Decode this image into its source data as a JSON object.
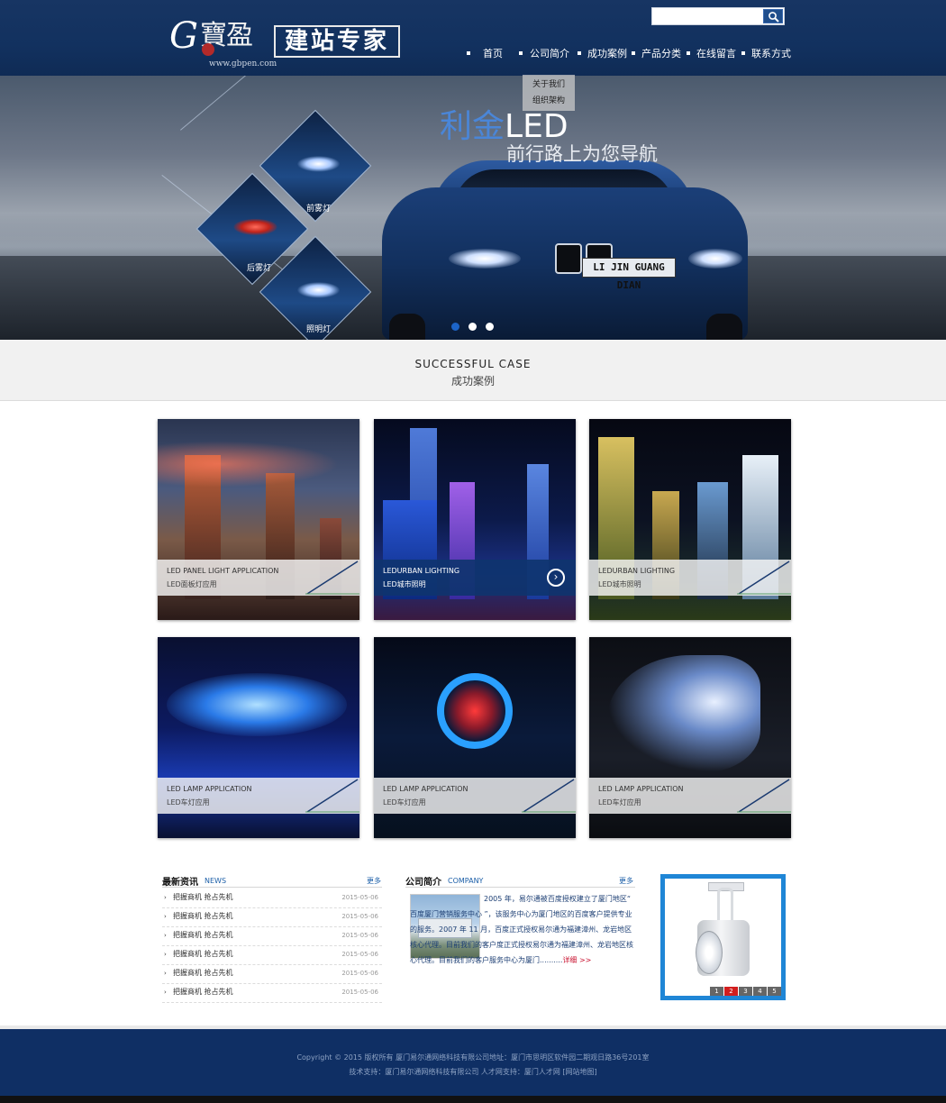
{
  "header": {
    "logo_g": "G",
    "logo_name": "寶盈",
    "logo_slogan": "建站专家",
    "logo_url": "www.gbpen.com",
    "search_placeholder": ""
  },
  "nav": {
    "items": [
      {
        "label": "首页"
      },
      {
        "label": "公司简介"
      },
      {
        "label": "成功案例"
      },
      {
        "label": "产品分类"
      },
      {
        "label": "在线留言"
      },
      {
        "label": "联系方式"
      }
    ],
    "dropdown": [
      "关于我们",
      "组织架构"
    ]
  },
  "banner": {
    "title_part1": "利金",
    "title_part2": "LED",
    "subtitle": "前行路上为您导航",
    "labels": [
      "前雾灯",
      "后雾灯",
      "照明灯"
    ],
    "plate": "LI JIN GUANG DIAN",
    "slides": 3,
    "active_slide": 1
  },
  "section": {
    "en": "SUCCESSFUL CASE",
    "cn": "成功案例"
  },
  "cases": [
    {
      "en": "LED PANEL LIGHT APPLICATION",
      "cn": "LED面板灯应用"
    },
    {
      "en": "LEDURBAN LIGHTING",
      "cn": "LED城市照明"
    },
    {
      "en": "LEDURBAN LIGHTING",
      "cn": "LED城市照明"
    },
    {
      "en": "LED LAMP APPLICATION",
      "cn": "LED车灯应用"
    },
    {
      "en": "LED LAMP APPLICATION",
      "cn": "LED车灯应用"
    },
    {
      "en": "LED LAMP APPLICATION",
      "cn": "LED车灯应用"
    }
  ],
  "news": {
    "title": "最新资讯",
    "sub": "NEWS",
    "more": "更多",
    "items": [
      {
        "title": "把握商机 抢占先机",
        "date": "2015-05-06"
      },
      {
        "title": "把握商机 抢占先机",
        "date": "2015-05-06"
      },
      {
        "title": "把握商机 抢占先机",
        "date": "2015-05-06"
      },
      {
        "title": "把握商机 抢占先机",
        "date": "2015-05-06"
      },
      {
        "title": "把握商机 抢占先机",
        "date": "2015-05-06"
      },
      {
        "title": "把握商机 抢占先机",
        "date": "2015-05-06"
      }
    ]
  },
  "company": {
    "title": "公司简介",
    "sub": "COMPANY",
    "more": "更多",
    "text": "2005 年，易尔通被百度授权建立了厦门地区“ 百度厦门营销服务中心 ”，该服务中心为厦门地区的百度客户提供专业的服务。2007 年 11 月，百度正式授权易尔通为福建漳州、龙岩地区核心代理。目前我们的客户度正式授权易尔通为福建漳州、龙岩地区核心代理。目前我们的客户服务中心为厦门..........",
    "detail": "详细 >>"
  },
  "product": {
    "pages": [
      "1",
      "2",
      "3",
      "4",
      "5"
    ],
    "active_page": "2"
  },
  "footer": {
    "line1": "Copyright © 2015 版权所有 厦门易尔通网络科技有限公司地址：厦门市思明区软件园二期观日路36号201室",
    "line2": "技术支持：厦门易尔通网络科技有限公司 人才网支持：厦门人才网 [网站地图]"
  },
  "colors": {
    "header_bg": "#12315f",
    "footer_bg": "#0f2f64",
    "accent_blue": "#1f86d6",
    "link_blue": "#1c5fa8",
    "active_red": "#d21e1e"
  }
}
